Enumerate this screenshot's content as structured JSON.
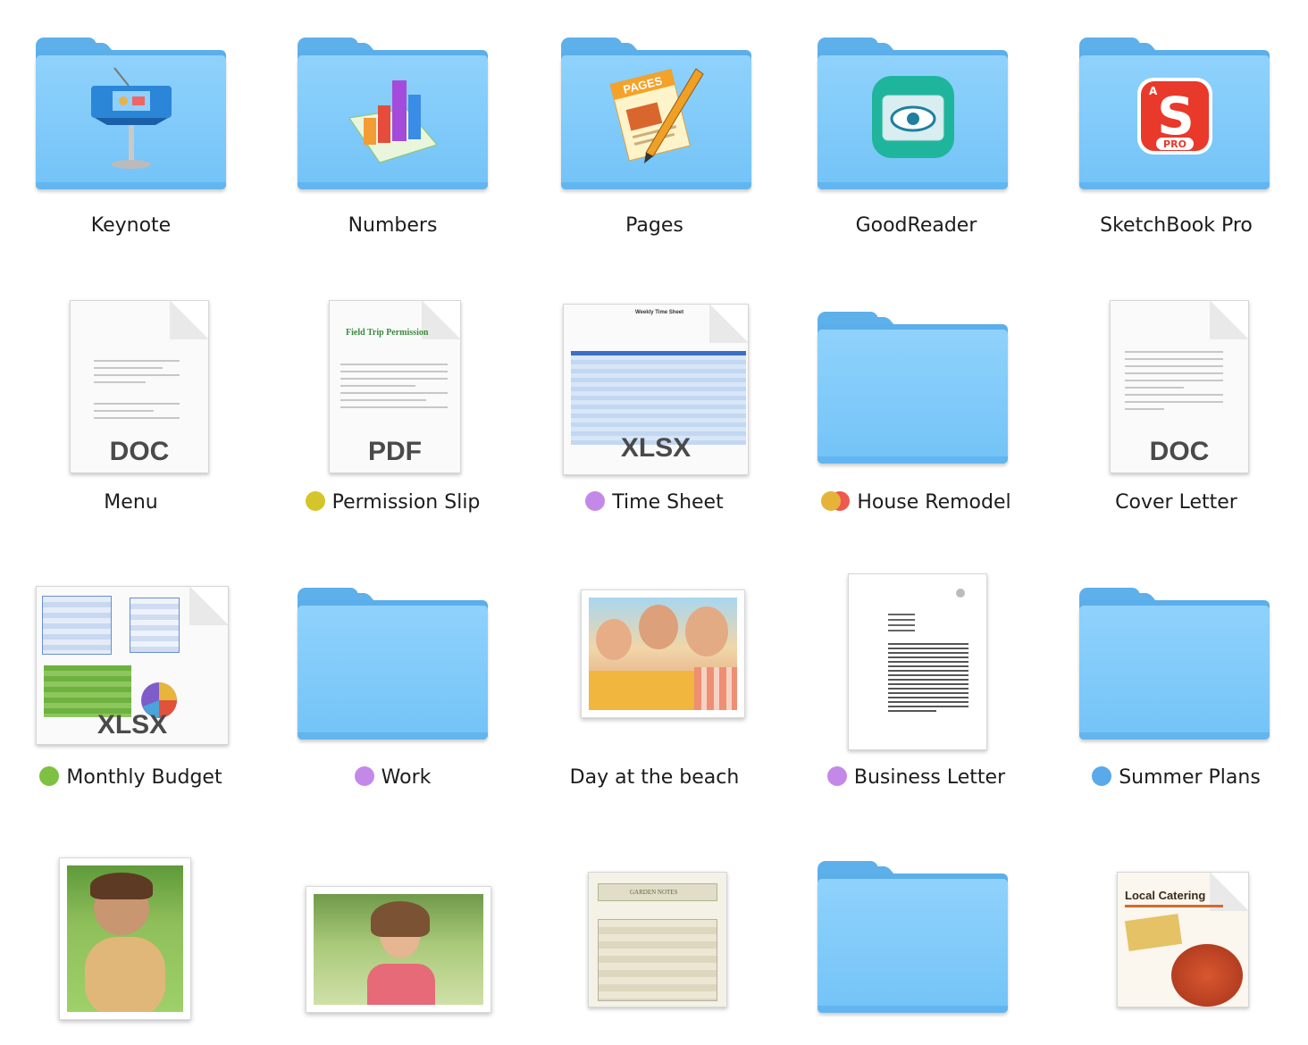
{
  "items": [
    {
      "label": "Keynote",
      "tags": []
    },
    {
      "label": "Numbers",
      "tags": []
    },
    {
      "label": "Pages",
      "tags": []
    },
    {
      "label": "GoodReader",
      "tags": []
    },
    {
      "label": "SketchBook Pro",
      "tags": []
    },
    {
      "label": "Menu",
      "tags": [],
      "ext": "DOC"
    },
    {
      "label": "Permission Slip",
      "tags": [
        "#d4c52a"
      ],
      "ext": "PDF",
      "doc_title": "Field Trip Permission"
    },
    {
      "label": "Time Sheet",
      "tags": [
        "#c489e8"
      ],
      "ext": "XLSX",
      "doc_title": "Weekly Time Sheet"
    },
    {
      "label": "House Remodel",
      "tags": [
        "#e6b33a",
        "#ee5a4f"
      ]
    },
    {
      "label": "Cover Letter",
      "tags": [],
      "ext": "DOC"
    },
    {
      "label": "Monthly Budget",
      "tags": [
        "#7ec142"
      ],
      "ext": "XLSX"
    },
    {
      "label": "Work",
      "tags": [
        "#c489e8"
      ]
    },
    {
      "label": "Day at the beach",
      "tags": []
    },
    {
      "label": "Business Letter",
      "tags": [
        "#c489e8"
      ]
    },
    {
      "label": "Summer Plans",
      "tags": [
        "#5aa9ea"
      ]
    },
    {
      "label": "",
      "tags": []
    },
    {
      "label": "",
      "tags": []
    },
    {
      "label": "",
      "tags": [],
      "doc_title": "GARDEN NOTES"
    },
    {
      "label": "",
      "tags": []
    },
    {
      "label": "",
      "tags": [],
      "doc_title": "Local Catering"
    }
  ],
  "badges": {
    "pages_text": "PAGES",
    "sketchbook_letter": "S",
    "sketchbook_pro": "PRO",
    "sketchbook_a": "A"
  },
  "colors": {
    "folder": "#7cc6f8",
    "folder_dark": "#5aaeea",
    "label_text": "#1c1c1c"
  }
}
